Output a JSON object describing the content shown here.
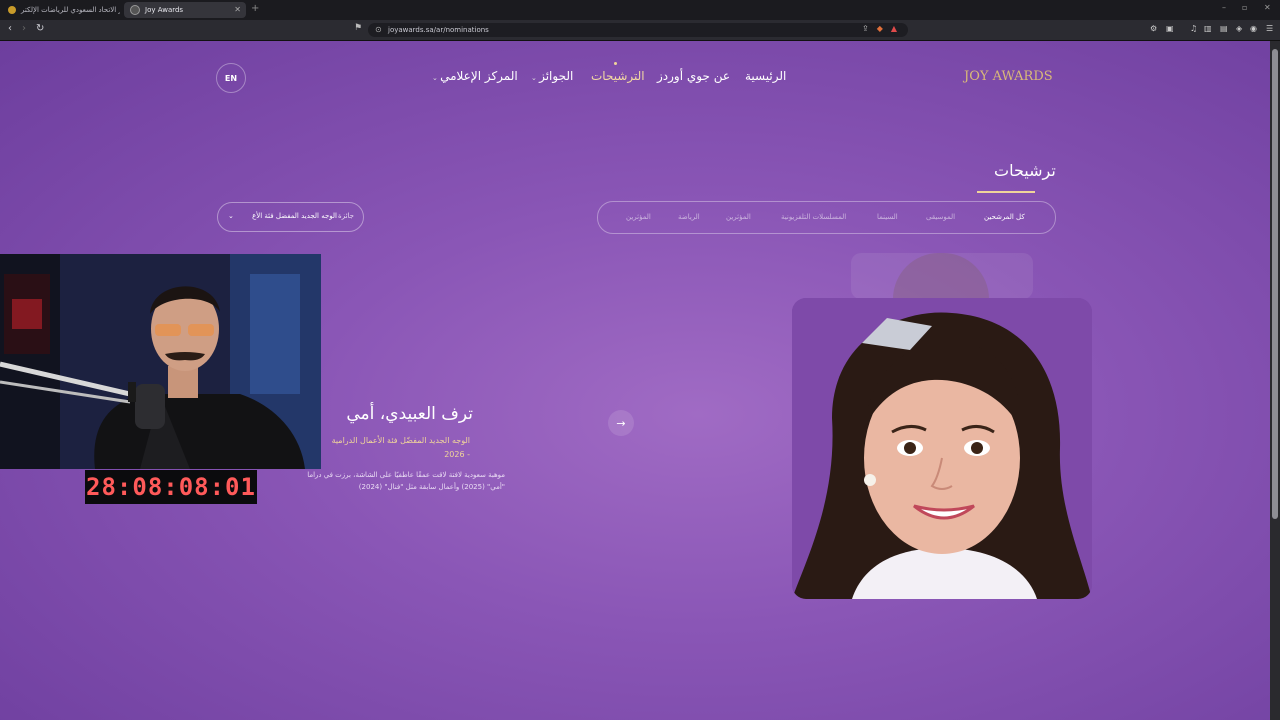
{
  "browser": {
    "tabs": [
      {
        "title": "جوائز الاتحاد السعودي للرياضات الإلكتر"
      },
      {
        "title": "Joy Awards"
      }
    ],
    "url": "joyawards.sa/ar/nominations"
  },
  "site": {
    "logo": "JOY AWARDS",
    "lang_button": "EN",
    "nav": [
      {
        "label": "الرئيسية"
      },
      {
        "label": "عن جوي أوردز"
      },
      {
        "label": "الترشيحات"
      },
      {
        "label": "الجوائز"
      },
      {
        "label": "المركز الإعلامي"
      }
    ],
    "page_title": "ترشيحات",
    "category_tabs": [
      {
        "label": "كل المرشحين"
      },
      {
        "label": "الموسيقى"
      },
      {
        "label": "السينما"
      },
      {
        "label": "المسلسلات التلفزيونية"
      },
      {
        "label": "المؤثرين"
      },
      {
        "label": "الرياضة"
      },
      {
        "label": "المؤثرين"
      }
    ],
    "filter": {
      "label": "جائزة",
      "value": "الوجه الجديد المفضل فئة الأع"
    },
    "nominee": {
      "name": "ترف العبيدي، أمي",
      "category": "الوجه الجديد المفضّل فئة الأعمال الدرامية - 2026",
      "description": "موهبة سعودية لافتة لاقت عمقًا عاطفيًا على الشاشة، برزت في دراما \"أمي\" (2025) وأعمال سابقة مثل \"فنال\" (2024)"
    }
  },
  "overlay": {
    "timer": "28:08:08:01"
  },
  "colors": {
    "accent": "#f0d49a",
    "page_bg": "#8a56b6",
    "timer": "#ff5a5a"
  }
}
